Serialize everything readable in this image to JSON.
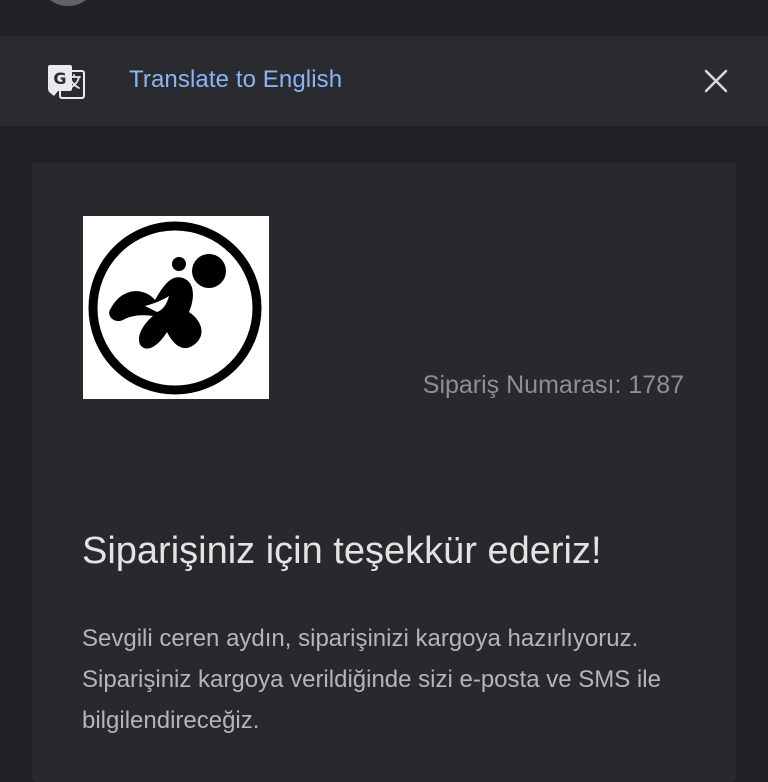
{
  "translate_bar": {
    "icon": "google-translate-icon",
    "label": "Translate to English",
    "close_icon": "close-icon",
    "accent_color": "#8ab4f8"
  },
  "email": {
    "logo": "brand-logo",
    "order_number": "Sipariş Numarası: 1787",
    "heading": "Siparişiniz için teşekkür ederiz!",
    "body": "Sevgili ceren aydın, siparişinizi kargoya hazırlıyoruz. Siparişiniz kargoya verildiğinde sizi e-posta ve SMS ile bilgilendireceğiz."
  }
}
